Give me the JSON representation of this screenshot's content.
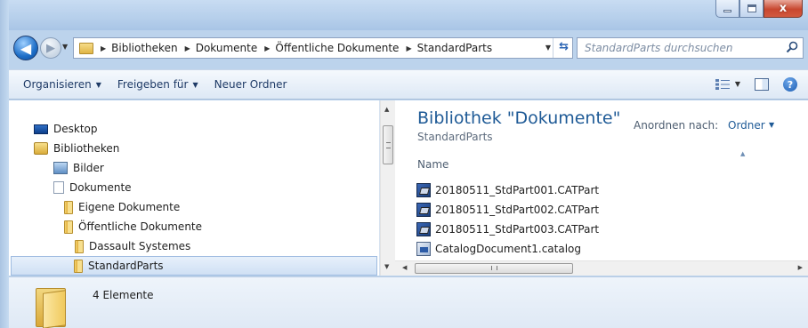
{
  "window": {
    "caption_buttons": [
      "minimize",
      "maximize",
      "close"
    ],
    "close_glyph": "x"
  },
  "nav": {
    "back_icon": "arrow-left-icon",
    "forward_icon": "arrow-right-icon"
  },
  "address": {
    "breadcrumbs": [
      "Bibliotheken",
      "Dokumente",
      "Öffentliche Dokumente",
      "StandardParts"
    ]
  },
  "search": {
    "placeholder": "StandardParts durchsuchen"
  },
  "toolbar": {
    "organize_label": "Organisieren",
    "share_label": "Freigeben für",
    "new_folder_label": "Neuer Ordner"
  },
  "tree": {
    "items": [
      {
        "label": "Desktop",
        "icon": "desktop-icon"
      },
      {
        "label": "Bibliotheken",
        "icon": "library-icon"
      },
      {
        "label": "Bilder",
        "icon": "pictures-icon"
      },
      {
        "label": "Dokumente",
        "icon": "documents-icon"
      },
      {
        "label": "Eigene Dokumente",
        "icon": "folder-icon"
      },
      {
        "label": "Öffentliche Dokumente",
        "icon": "folder-icon"
      },
      {
        "label": "Dassault Systemes",
        "icon": "folder-icon"
      },
      {
        "label": "StandardParts",
        "icon": "folder-icon",
        "selected": true
      }
    ]
  },
  "library": {
    "title": "Bibliothek \"Dokumente\"",
    "subtitle": "StandardParts",
    "arrange_label": "Anordnen nach:",
    "arrange_value": "Ordner",
    "column_name": "Name"
  },
  "files": [
    {
      "name": "20180511_StdPart001.CATPart",
      "icon": "catpart-icon"
    },
    {
      "name": "20180511_StdPart002.CATPart",
      "icon": "catpart-icon"
    },
    {
      "name": "20180511_StdPart003.CATPart",
      "icon": "catpart-icon"
    },
    {
      "name": "CatalogDocument1.catalog",
      "icon": "catalog-icon"
    }
  ],
  "details": {
    "count_text": "4 Elemente"
  },
  "colors": {
    "accent": "#1e5a96",
    "frame": "#bcd3ec"
  }
}
